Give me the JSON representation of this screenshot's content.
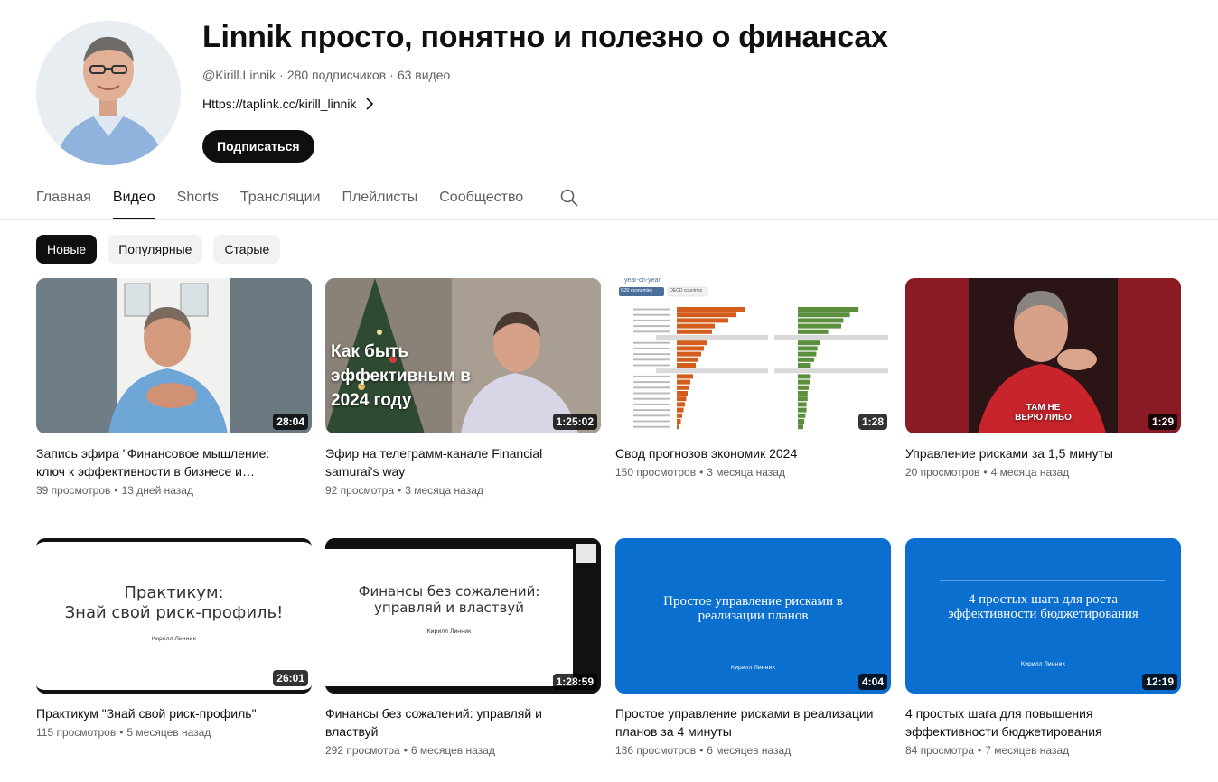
{
  "channel": {
    "title": "Linnik просто, понятно и полезно о финансах",
    "handle": "@Kirill.Linnik",
    "subscribers": "280 подписчиков",
    "videos_count": "63 видео",
    "link": "Https://taplink.cc/kirill_linnik",
    "subscribe_label": "Подписаться"
  },
  "tabs": [
    {
      "label": "Главная"
    },
    {
      "label": "Видео"
    },
    {
      "label": "Shorts"
    },
    {
      "label": "Трансляции"
    },
    {
      "label": "Плейлисты"
    },
    {
      "label": "Сообщество"
    }
  ],
  "chips": [
    {
      "label": "Новые"
    },
    {
      "label": "Популярные"
    },
    {
      "label": "Старые"
    }
  ],
  "videos": [
    {
      "title": "Запись эфира \"Финансовое мышление: ключ к эффективности в бизнесе и…",
      "views": "39 просмотров",
      "age": "13 дней назад",
      "duration": "28:04"
    },
    {
      "title": "Эфир на телеграмм-канале Financial samurai's way",
      "views": "92 просмотра",
      "age": "3 месяца назад",
      "duration": "1:25:02",
      "overlay": [
        "Как быть",
        "эффективным в",
        "2024 году"
      ]
    },
    {
      "title": "Свод прогнозов экономик 2024",
      "views": "150 просмотров",
      "age": "3 месяца назад",
      "duration": "1:28",
      "overlay_tabs": [
        "G20 economies",
        "OECD countries"
      ],
      "overlay_label": "year-on-year"
    },
    {
      "title": "Управление рисками за 1,5 минуты",
      "views": "20 просмотров",
      "age": "4 месяца назад",
      "duration": "1:29",
      "overlay": [
        "ТАМ НЕ",
        "ВЕРЮ ЛИБО"
      ]
    },
    {
      "title": "Практикум \"Знай свой риск-профиль\"",
      "views": "115 просмотров",
      "age": "5 месяцев назад",
      "duration": "26:01",
      "overlay": [
        "Практикум:",
        "Знай свой риск-профиль!"
      ],
      "author": "Кирилл Линник"
    },
    {
      "title": "Финансы без сожалений: управляй и властвуй",
      "views": "292 просмотра",
      "age": "6 месяцев назад",
      "duration": "1:28:59",
      "overlay": [
        "Финансы без сожалений:",
        "управляй и властвуй"
      ],
      "author": "Кирилл Линник"
    },
    {
      "title": "Простое управление рисками в реализации планов за 4 минуты",
      "views": "136 просмотров",
      "age": "6 месяцев назад",
      "duration": "4:04",
      "overlay": [
        "Простое управление рисками в",
        "реализации планов"
      ],
      "author": "Кирилл Линник"
    },
    {
      "title": "4 простых шага для повышения эффективности бюджетирования",
      "views": "84 просмотра",
      "age": "7 месяцев назад",
      "duration": "12:19",
      "overlay": [
        "4 простых шага для роста",
        "эффективности бюджетирования"
      ],
      "author": "Кирилл Линник"
    }
  ],
  "icons": {
    "search": "search-icon",
    "link_chevron": "chevron-right-icon"
  },
  "colors": {
    "accent": "#0f0f0f",
    "muted": "#606060",
    "chip_bg": "#f2f2f2",
    "slide_blue": "#0a6fcf",
    "thumb_red": "#8a1a24"
  }
}
